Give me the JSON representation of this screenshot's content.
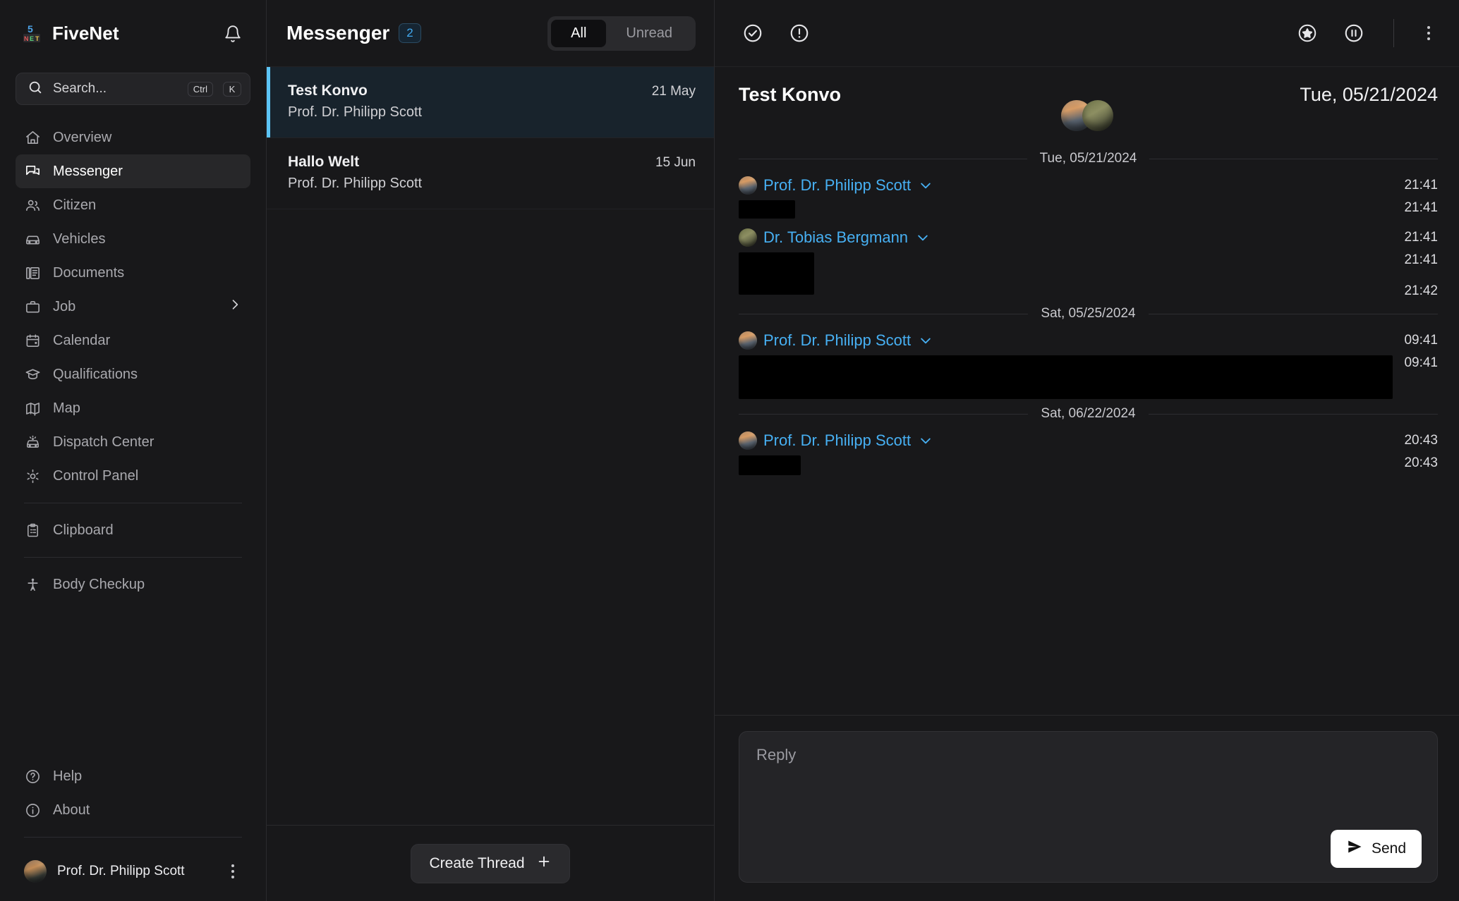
{
  "app": {
    "brand": "FiveNet",
    "brand_logo_icon": "fivenet-logo-icon",
    "notifications_icon": "bell-icon"
  },
  "search": {
    "placeholder": "Search...",
    "icon": "search-icon",
    "shortcut_modifier": "Ctrl",
    "shortcut_key": "K"
  },
  "sidebar": {
    "items": [
      {
        "label": "Overview",
        "icon": "home-icon",
        "active": false
      },
      {
        "label": "Messenger",
        "icon": "messenger-icon",
        "active": true
      },
      {
        "label": "Citizen",
        "icon": "users-icon",
        "active": false
      },
      {
        "label": "Vehicles",
        "icon": "car-icon",
        "active": false
      },
      {
        "label": "Documents",
        "icon": "documents-icon",
        "active": false
      },
      {
        "label": "Job",
        "icon": "briefcase-icon",
        "active": false,
        "expandable": true
      },
      {
        "label": "Calendar",
        "icon": "calendar-icon",
        "active": false
      },
      {
        "label": "Qualifications",
        "icon": "graduation-icon",
        "active": false
      },
      {
        "label": "Map",
        "icon": "map-icon",
        "active": false
      },
      {
        "label": "Dispatch Center",
        "icon": "dispatch-icon",
        "active": false
      },
      {
        "label": "Control Panel",
        "icon": "gear-icon",
        "active": false
      }
    ],
    "clipboard": {
      "label": "Clipboard",
      "icon": "clipboard-icon"
    },
    "body_checkup": {
      "label": "Body Checkup",
      "icon": "body-icon"
    },
    "help": {
      "label": "Help",
      "icon": "question-circle-icon"
    },
    "about": {
      "label": "About",
      "icon": "info-circle-icon"
    },
    "profile": {
      "name": "Prof. Dr. Philipp Scott",
      "avatar_icon": "avatar",
      "menu_icon": "three-dots-vertical-icon"
    }
  },
  "threads_panel": {
    "title": "Messenger",
    "unread_count": "2",
    "filters": [
      {
        "label": "All",
        "selected": true
      },
      {
        "label": "Unread",
        "selected": false
      }
    ],
    "threads": [
      {
        "name": "Test Konvo",
        "author": "Prof. Dr. Philipp Scott",
        "date": "21 May",
        "selected": true
      },
      {
        "name": "Hallo Welt",
        "author": "Prof. Dr. Philipp Scott",
        "date": "15 Jun",
        "selected": false
      }
    ],
    "create_button": {
      "label": "Create Thread",
      "icon": "plus-icon"
    }
  },
  "conversation": {
    "toolbar_left": [
      {
        "icon": "check-circle-icon"
      },
      {
        "icon": "alert-circle-icon"
      }
    ],
    "toolbar_right": [
      {
        "icon": "star-circle-icon"
      },
      {
        "icon": "pause-circle-icon"
      },
      {
        "icon": "three-dots-vertical-icon"
      }
    ],
    "title": "Test Konvo",
    "date": "Tue, 05/21/2024",
    "participants": [
      {
        "name": "Prof. Dr. Philipp Scott",
        "avatar_icon": "avatar"
      },
      {
        "name": "Dr. Tobias Bergmann",
        "avatar_icon": "avatar"
      }
    ],
    "groups": [
      {
        "day": "Tue, 05/21/2024",
        "messages": [
          {
            "author": "Prof. Dr. Philipp Scott",
            "avatar": "a",
            "header_time": "21:41",
            "body_time": "21:41",
            "redacted_width": 80,
            "redacted_height": 26,
            "extra_time": null
          },
          {
            "author": "Dr. Tobias Bergmann",
            "avatar": "b",
            "header_time": "21:41",
            "body_time": "21:41",
            "redacted_width": 107,
            "redacted_height": 60,
            "extra_time": "21:42"
          }
        ]
      },
      {
        "day": "Sat, 05/25/2024",
        "messages": [
          {
            "author": "Prof. Dr. Philipp Scott",
            "avatar": "a",
            "header_time": "09:41",
            "body_time": "09:41",
            "redacted_width": 965,
            "redacted_height": 62,
            "extra_time": null
          }
        ]
      },
      {
        "day": "Sat, 06/22/2024",
        "messages": [
          {
            "author": "Prof. Dr. Philipp Scott",
            "avatar": "a",
            "header_time": "20:43",
            "body_time": "20:43",
            "redacted_width": 88,
            "redacted_height": 28,
            "extra_time": null
          }
        ]
      }
    ],
    "composer": {
      "placeholder": "Reply",
      "send_label": "Send",
      "send_icon": "send-icon"
    }
  },
  "colors": {
    "background": "#18181a",
    "panel_border": "#2a2a2d",
    "accent_blue": "#47b0f3",
    "selected_thread_bg": "#18232c",
    "selected_thread_bar": "#5cc4f5",
    "badge_text": "#41a9f0",
    "redaction": "#000000"
  }
}
